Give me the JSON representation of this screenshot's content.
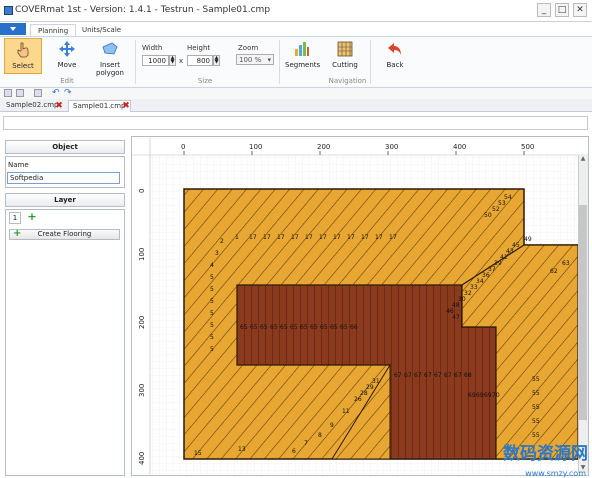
{
  "window": {
    "title": "COVERmat 1st - Version: 1.4.1 - Testrun - Sample01.cmp",
    "min": "_",
    "max": "□",
    "close": "✕"
  },
  "ribbon": {
    "tabs": [
      "Planning",
      "Units/Scale"
    ],
    "buttons": {
      "select": "Select",
      "move": "Move",
      "insert_polygon": "Insert polygon",
      "segments": "Segments",
      "cutting": "Cutting",
      "back": "Back"
    },
    "width_label": "Width",
    "width_value": "1000",
    "height_label": "Height",
    "height_value": "800",
    "zoom_label": "Zoom",
    "zoom_value": "100 %",
    "times": "x",
    "groups": {
      "edit": "Edit",
      "size": "Size",
      "navigation": "Navigation"
    }
  },
  "doc_tabs": [
    "Sample02.cmp",
    "Sample01.cmp"
  ],
  "panel": {
    "object_header": "Object",
    "name_label": "Name",
    "name_value": "Softpedia",
    "layer_header": "Layer",
    "layer_tab": "1",
    "create_flooring": "Create Flooring"
  },
  "canvas": {
    "x_ticks": [
      "0",
      "100",
      "200",
      "300",
      "400",
      "500"
    ],
    "y_ticks": [
      "0",
      "100",
      "200",
      "300",
      "400"
    ],
    "pieces": {
      "top_row": [
        "1",
        "17",
        "17",
        "17",
        "17",
        "17",
        "17",
        "17",
        "17",
        "17",
        "17",
        "17"
      ],
      "left_col": [
        "2",
        "3",
        "4",
        "5",
        "5",
        "5",
        "5",
        "5",
        "5",
        "5"
      ],
      "right_diag": [
        "54",
        "53",
        "52",
        "50",
        "49",
        "45",
        "43",
        "41",
        "39",
        "37",
        "36",
        "34",
        "33",
        "32",
        "30",
        "48",
        "46",
        "47",
        "63",
        "62"
      ],
      "inner_row": [
        "65",
        "65",
        "65",
        "65",
        "65",
        "65",
        "65",
        "65",
        "65",
        "65",
        "65",
        "66"
      ],
      "low_row": [
        "67",
        "67",
        "67",
        "67",
        "67",
        "67",
        "67",
        "68"
      ],
      "right_small": [
        "69",
        "69",
        "69",
        "70"
      ],
      "bottom_left": [
        "31",
        "29",
        "28",
        "26",
        "11",
        "9",
        "8",
        "7",
        "6",
        "13",
        "15"
      ],
      "right_col": [
        "55",
        "55",
        "55",
        "55",
        "55"
      ]
    },
    "colors": {
      "light_wood": "#E8A632",
      "dark_wood": "#8B3A1E",
      "outline": "#2a1a0a"
    }
  },
  "watermark": {
    "text": "数码资源网",
    "url": "www.smzy.com"
  }
}
